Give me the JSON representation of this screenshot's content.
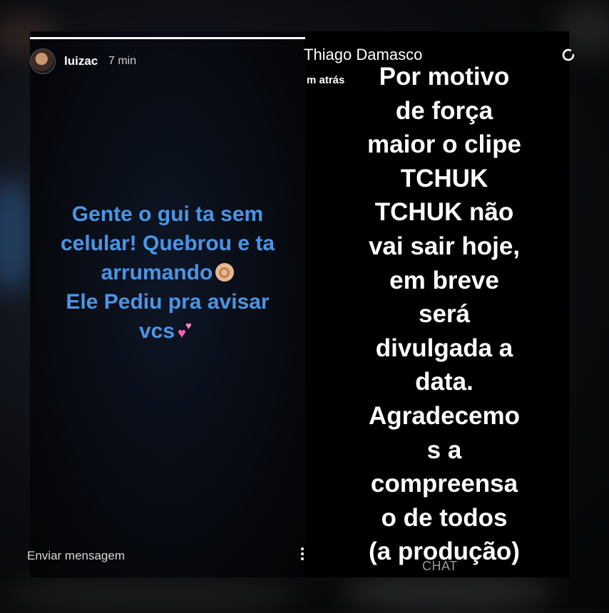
{
  "left_story": {
    "username": "luizac",
    "time": "7 min",
    "progress": 1.0,
    "lines": [
      "Gente o gui  ta sem",
      "celular! Quebrou e ta",
      "arrumando",
      "Ele Pediu pra avisar",
      "vcs"
    ],
    "emoji_ok": "ok-hand-emoji",
    "emoji_hearts": "two-hearts-emoji",
    "send_message_placeholder": "Enviar mensagem",
    "text_color": "#4b95e6"
  },
  "right_story": {
    "poster_name": "Thiago Damasco",
    "poster_time": "m atrás",
    "lines": [
      "Por motivo",
      "de força",
      "maior o clipe",
      "TCHUK",
      "TCHUK não",
      "vai sair hoje,",
      "em breve",
      "será",
      "divulgada a",
      "data.",
      "Agradecemo",
      "s a",
      "compreensa",
      "o de todos",
      "(a produção)"
    ],
    "chat_label": "CHAT"
  }
}
